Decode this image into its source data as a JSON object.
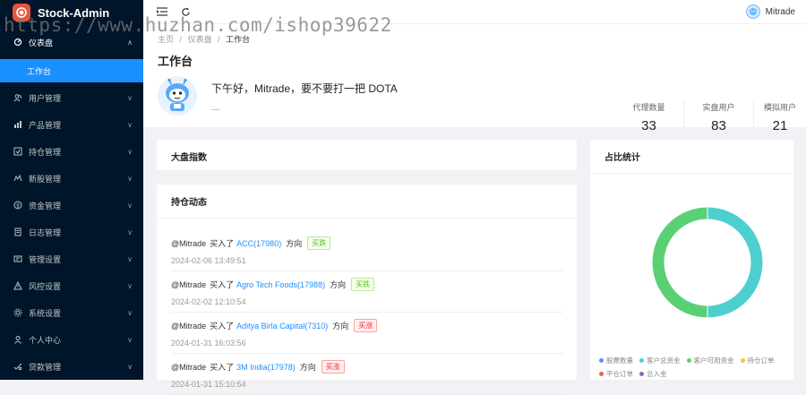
{
  "app": {
    "title": "Stock-Admin"
  },
  "sidebar": {
    "dashboard": {
      "label": "仪表盘",
      "chev": "∧"
    },
    "workbench": {
      "label": "工作台"
    },
    "items": [
      {
        "label": "用户管理",
        "icon": "users-icon",
        "chev": "∨"
      },
      {
        "label": "产品管理",
        "icon": "chart-icon",
        "chev": "∨"
      },
      {
        "label": "持仓管理",
        "icon": "position-icon",
        "chev": "∨"
      },
      {
        "label": "新股管理",
        "icon": "ipo-icon",
        "chev": "∨"
      },
      {
        "label": "资金管理",
        "icon": "money-icon",
        "chev": "∨"
      },
      {
        "label": "日志管理",
        "icon": "log-icon",
        "chev": "∨"
      },
      {
        "label": "管理设置",
        "icon": "admin-settings-icon",
        "chev": "∨"
      },
      {
        "label": "风控设置",
        "icon": "risk-icon",
        "chev": "∨"
      },
      {
        "label": "系统设置",
        "icon": "gear-icon",
        "chev": "∨"
      },
      {
        "label": "个人中心",
        "icon": "user-icon",
        "chev": "∨"
      },
      {
        "label": "贷款管理",
        "icon": "loan-icon",
        "chev": "∨"
      }
    ]
  },
  "topbar": {
    "username": "Mitrade"
  },
  "breadcrumb": {
    "home": "主页",
    "sep": "/",
    "parent": "仪表盘",
    "current": "工作台"
  },
  "page": {
    "title": "工作台",
    "greeting": "下午好，Mitrade，要不要打一把 DOTA",
    "sub": "—"
  },
  "stats": [
    {
      "label": "代理数量",
      "value": "33"
    },
    {
      "label": "实盘用户",
      "value": "83"
    },
    {
      "label": "模拟用户",
      "value": "21"
    }
  ],
  "cards": {
    "market": {
      "title": "大盘指数"
    },
    "positions": {
      "title": "持仓动态"
    },
    "ratio": {
      "title": "占比统计"
    }
  },
  "feed": [
    {
      "user": "@Mitrade",
      "action": "买入了",
      "stock": "ACC(17980)",
      "dir": "方向",
      "tag": "买跌",
      "type": "buy",
      "time": "2024-02-06 13:49:51"
    },
    {
      "user": "@Mitrade",
      "action": "买入了",
      "stock": "Agro Tech Foods(17988)",
      "dir": "方向",
      "tag": "买跌",
      "type": "buy",
      "time": "2024-02-02 12:10:54"
    },
    {
      "user": "@Mitrade",
      "action": "买入了",
      "stock": "Aditya Birla Capital(7310)",
      "dir": "方向",
      "tag": "买涨",
      "type": "sell",
      "time": "2024-01-31 16:03:56"
    },
    {
      "user": "@Mitrade",
      "action": "买入了",
      "stock": "3M India(17978)",
      "dir": "方向",
      "tag": "买涨",
      "type": "sell",
      "time": "2024-01-31 15:10:54"
    }
  ],
  "chart_data": {
    "type": "pie",
    "categories": [
      "股票数量",
      "客户总资金",
      "客户可用资金",
      "持仓订单",
      "平仓订单",
      "总入金"
    ],
    "colors": [
      "#5b8ff9",
      "#4ecfcf",
      "#5ad075",
      "#f6c244",
      "#e86452",
      "#9661bc"
    ],
    "values": [
      0,
      50,
      50,
      0,
      0,
      0
    ],
    "donut": true,
    "legend_position": "bottom"
  },
  "watermark": {
    "text": "https://www.huzhan.com/ishop39622"
  }
}
